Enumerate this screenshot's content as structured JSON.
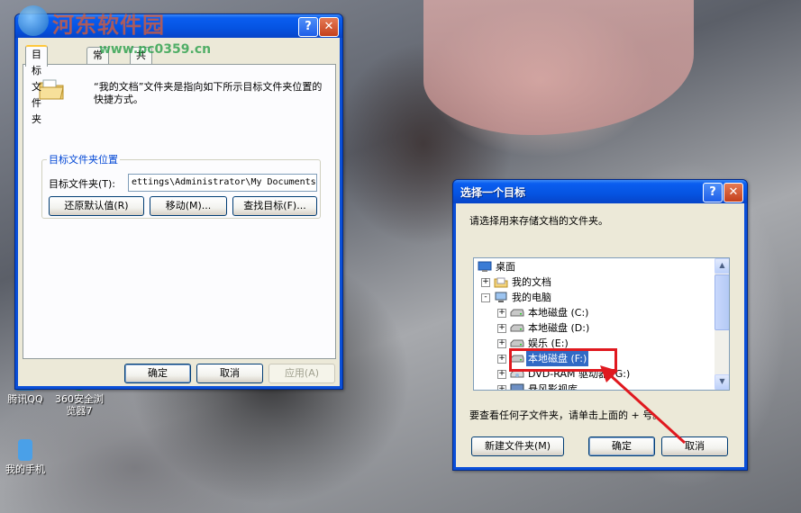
{
  "desktop": {
    "icons": [
      {
        "label": "腾讯QQ",
        "color": "#2a8be0"
      },
      {
        "label": "360安全浏览器7",
        "color": "#3fa24a"
      },
      {
        "label": "我的手机",
        "color": "#4aa0e8"
      }
    ],
    "watermark": {
      "title": "河东软件园",
      "url": "www.pc0359.cn"
    }
  },
  "properties_dialog": {
    "tabs": [
      "目标文件夹",
      "常规",
      "共享"
    ],
    "active_tab": 0,
    "description": "“我的文档”文件夹是指向如下所示目标文件夹位置的快捷方式。",
    "group_title": "目标文件夹位置",
    "target_label": "目标文件夹(T):",
    "target_value": "ettings\\Administrator\\My Documents",
    "restore_button": "还原默认值(R)",
    "move_button": "移动(M)...",
    "find_target_button": "查找目标(F)...",
    "ok_button": "确定",
    "cancel_button": "取消",
    "apply_button": "应用(A)"
  },
  "browse_dialog": {
    "title": "选择一个目标",
    "instruction": "请选择用来存储文档的文件夹。",
    "tree": [
      {
        "label": "桌面",
        "icon": "desktop-icon",
        "expander": ""
      },
      {
        "label": "我的文档",
        "icon": "my-documents-icon",
        "expander": "+"
      },
      {
        "label": "我的电脑",
        "icon": "my-computer-icon",
        "expander": "-"
      },
      {
        "label": "本地磁盘 (C:)",
        "icon": "drive-icon",
        "expander": "+"
      },
      {
        "label": "本地磁盘 (D:)",
        "icon": "drive-icon",
        "expander": "+"
      },
      {
        "label": "娱乐 (E:)",
        "icon": "drive-icon",
        "expander": "+"
      },
      {
        "label": "本地磁盘 (F:)",
        "icon": "drive-icon",
        "expander": "+",
        "selected": true
      },
      {
        "label": "DVD-RAM 驱动器 (G:)",
        "icon": "dvd-drive-icon",
        "expander": "+"
      },
      {
        "label": "悬风影视库",
        "icon": "folder-icon",
        "expander": "+"
      }
    ],
    "hint": "要查看任何子文件夹，请单击上面的 + 号。",
    "new_folder_button": "新建文件夹(M)",
    "ok_button": "确定",
    "cancel_button": "取消"
  },
  "colors": {
    "annotation_red": "#e0191f",
    "xp_blue": "#0a4fd8"
  }
}
